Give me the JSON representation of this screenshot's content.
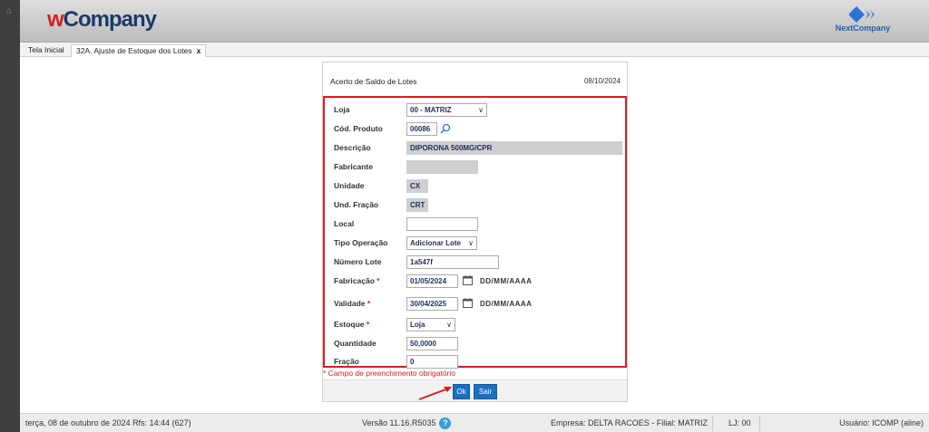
{
  "header": {
    "brand_w": "w",
    "brand_rest": "Company",
    "partner": "NextCompany"
  },
  "tabs": [
    {
      "label": "Tela Inicial"
    },
    {
      "label": "32A. Ajuste de Estoque dos Lotes",
      "close": "x"
    }
  ],
  "panel": {
    "title": "Acerto de Saldo de Lotes",
    "date": "08/10/2024"
  },
  "form": {
    "loja": {
      "label": "Loja",
      "value": "00 - MATRIZ"
    },
    "cod_produto": {
      "label": "Cód. Produto",
      "value": "00086"
    },
    "descricao": {
      "label": "Descrição",
      "value": "DIPORONA 500MG/CPR"
    },
    "fabricante": {
      "label": "Fabricante",
      "value": ""
    },
    "unidade": {
      "label": "Unidade",
      "value": "CX"
    },
    "und_fracao": {
      "label": "Und. Fração",
      "value": "CRT"
    },
    "local": {
      "label": "Local",
      "value": ""
    },
    "tipo_operacao": {
      "label": "Tipo Operação",
      "value": "Adicionar Lote"
    },
    "numero_lote": {
      "label": "Número Lote",
      "value": "1a547f"
    },
    "fabricacao": {
      "label": "Fabricação",
      "value": "01/05/2024",
      "format": "DD/MM/AAAA"
    },
    "validade": {
      "label": "Validade",
      "value": "30/04/2025",
      "format": "DD/MM/AAAA"
    },
    "estoque": {
      "label": "Estoque",
      "value": "Loja"
    },
    "quantidade": {
      "label": "Quantidade",
      "value": "50,0000"
    },
    "fracao": {
      "label": "Fração",
      "value": "0"
    },
    "required_mark": "*"
  },
  "required_note": "* Campo de preenchimento obrigatório",
  "buttons": {
    "ok": "Ok",
    "sair": "Sair"
  },
  "statusbar": {
    "datetime": "terça, 08 de outubro de 2024  Rfs: 14:44 (627)",
    "version": "Versão 11.16.R5035",
    "help": "?",
    "empresa": "Empresa: DELTA RACOES - Filial: MATRIZ",
    "lj": "LJ: 00",
    "usuario": "Usuário: ICOMP (aline)"
  },
  "colors": {
    "accent": "#1c70c0",
    "highlight_border": "#e11a1a",
    "brand_red": "#d32020",
    "brand_blue": "#1c3a6b"
  }
}
